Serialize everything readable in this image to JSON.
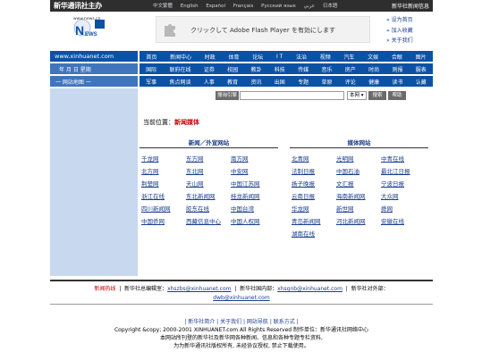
{
  "topbar": {
    "logo": "新华通讯社主办",
    "languages": [
      "中文繁體",
      "English",
      "Español",
      "Français",
      "Русский язык",
      "عربي",
      "日本語"
    ],
    "right_link": "新华社新闻信息"
  },
  "header": {
    "site_url": "www.news.cn",
    "logo_text": "NEWS 新华网",
    "flash_message": "クリックして Adobe Flash Player を有効にします",
    "right_links": [
      "设为首页",
      "加入收藏",
      "关于我们"
    ]
  },
  "left": {
    "url": "www.xinhuanet.com",
    "date_label": "年   月   日 星期",
    "map_label": "一 网站地图 一"
  },
  "nav": {
    "row1": [
      "首页",
      "新闻中心",
      "时政",
      "体育",
      "论坛",
      "I T",
      "法治",
      "视频",
      "汽车",
      "文娱",
      "合眼",
      "图片"
    ],
    "row2": [
      "国际",
      "联府在线",
      "证券",
      "校园",
      "教卦",
      "科技",
      "传媒",
      "音乐",
      "房产",
      "时尚",
      "则报",
      "服表"
    ],
    "row3": [
      "军事",
      "焦点网谈",
      "人事",
      "教育",
      "资讯",
      "出国",
      "专题",
      "草原",
      "评论",
      "健康",
      "读书",
      "认藏"
    ]
  },
  "search": {
    "label": "搜询引擎",
    "placeholder": "",
    "select_value": "本网",
    "go_label": "搜索",
    "help_label": "帮助"
  },
  "breadcrumb": {
    "prefix": "当前位置：",
    "current": "新闻媒体"
  },
  "sections": {
    "left_title": "新闻／外宣网站",
    "right_title": "媒体网站",
    "left_links": [
      [
        "千龙网",
        "东方网",
        "南方网"
      ],
      [
        "北方网",
        "东北网",
        "中安网"
      ],
      [
        "荆楚网",
        "天山网",
        "中国江苏网"
      ],
      [
        "浙江在线",
        "东北新闻网",
        "桂龙新闻网"
      ],
      [
        "四川新闻网",
        "胶东在线",
        "中国台湾"
      ],
      [
        "中国侨网",
        "西藏信息中心",
        "中国人权网"
      ]
    ],
    "right_links": [
      [
        "北青网",
        "光明网",
        "中青在线"
      ],
      [
        "法制日报",
        "中国石油",
        "最北江日报"
      ],
      [
        "扬子晚报",
        "文汇报",
        "宁波日报"
      ],
      [
        "云南日报",
        "海南新闻网",
        "大众网"
      ],
      [
        "华龙网",
        "新世网",
        "舜网"
      ],
      [
        "青岛新闻网",
        "河北新闻网",
        "安徽在线"
      ],
      [
        "湖南在线",
        "",
        ""
      ]
    ]
  },
  "hotline": {
    "label": "新闻热线",
    "item1": "新华社总编辑室：",
    "email1": "xhszbs@xinhuanet.com",
    "item2": "新华社国内部：",
    "email2": "xhsgnb@xinhuanet.com",
    "item3": "新华社对外部：",
    "email3": "dwb@xinhuanet.com"
  },
  "footer": {
    "links_line": "| 新华社简介 | 关于我们 | 网站导航 | 联系方式 |",
    "copyright": "Copyright &copy; 2000-2001 XINHUANET.com    All Rights Reserved  制作单位：新华通讯社网络中心",
    "line3": "本网站所刊登的新华社及新华网各种新闻、信息和各种专题专栏资料,",
    "line4": "为为新华通讯社版权所有, 未经协议授权, 禁止下载使用。"
  }
}
